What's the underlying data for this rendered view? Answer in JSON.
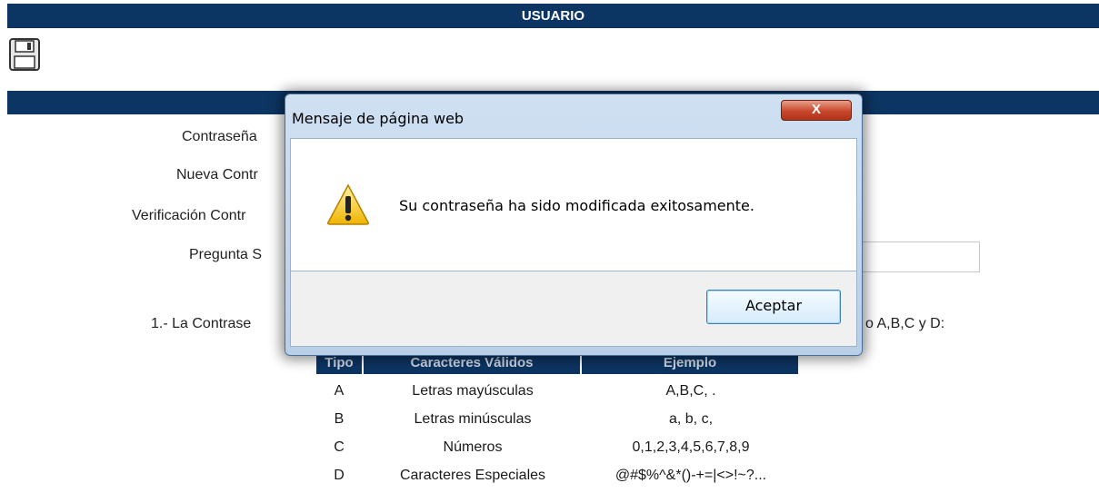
{
  "page": {
    "title": "USUARIO"
  },
  "icons": {
    "save": "save-icon"
  },
  "form": {
    "labels": {
      "current_password": "Contraseña",
      "new_password": "Nueva Contr",
      "verify_password": "Verificación Contr",
      "security_question": "Pregunta S"
    }
  },
  "rules": {
    "intro_start": "1.- La Contrase",
    "intro_end": "o A,B,C y D:",
    "table": {
      "headers": [
        "Tipo",
        "Caracteres Válidos",
        "Ejemplo"
      ],
      "rows": [
        {
          "type": "A",
          "valid": "Letras mayúsculas",
          "example": "A,B,C,  ."
        },
        {
          "type": "B",
          "valid": "Letras minúsculas",
          "example": "a, b, c,"
        },
        {
          "type": "C",
          "valid": "Números",
          "example": "0,1,2,3,4,5,6,7,8,9"
        },
        {
          "type": "D",
          "valid": "Caracteres Especiales",
          "example": "@#$%^&*()-+=|<>!~?..."
        }
      ]
    }
  },
  "dialog": {
    "title": "Mensaje de página web",
    "close_label": "X",
    "message": "Su contraseña ha sido modificada exitosamente.",
    "accept_label": "Aceptar",
    "icon": "warning-icon"
  },
  "colors": {
    "header_bar": "#0d3563",
    "dialog_frame": "#c4d8ee",
    "close_button": "#c7472a"
  }
}
